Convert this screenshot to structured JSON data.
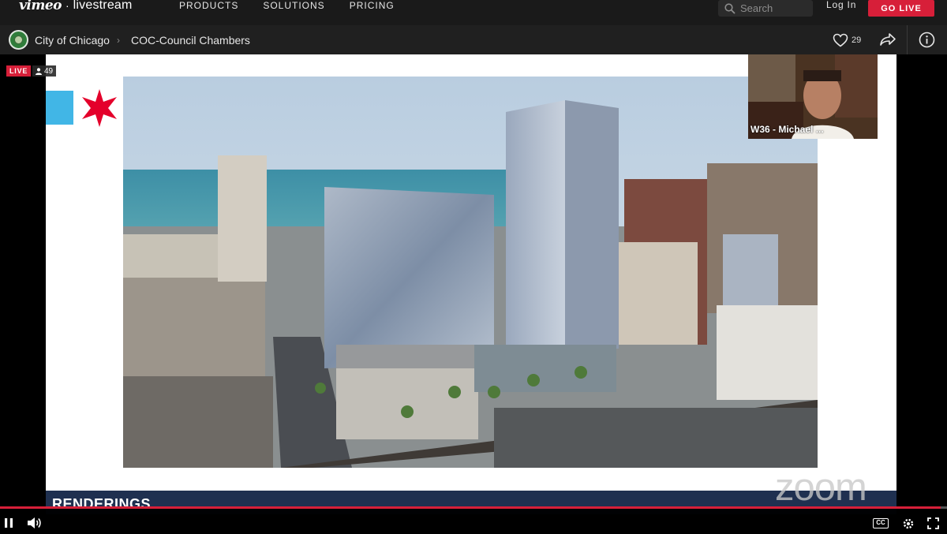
{
  "brand": {
    "vimeo": "vimeo",
    "separator": "·",
    "livestream": "livestream"
  },
  "nav": {
    "items": [
      "PRODUCTS",
      "SOLUTIONS",
      "PRICING"
    ]
  },
  "search": {
    "placeholder": "Search"
  },
  "auth": {
    "login": "Log In",
    "go_live": "GO LIVE"
  },
  "channel": {
    "breadcrumb": [
      "City of Chicago",
      "COC-Council Chambers"
    ],
    "likes": "29"
  },
  "stream": {
    "live_label": "LIVE",
    "viewers": "49",
    "participant": "W36 - Michael ...",
    "slide_footer": "RENDERINGS",
    "watermark": "zoom",
    "progress_fraction": 0.993
  },
  "icons": {
    "search": "search-icon",
    "heart": "heart-icon",
    "share": "share-icon",
    "info": "info-icon",
    "pause": "pause-icon",
    "volume": "volume-icon",
    "cc": "closed-captions-icon",
    "settings": "settings-icon",
    "fullscreen": "fullscreen-icon",
    "viewer": "person-icon"
  },
  "colors": {
    "accent": "#d71f39",
    "chicago_blue": "#41b6e6",
    "chicago_red": "#e4002b"
  },
  "controls": {
    "cc_label": "CC"
  }
}
